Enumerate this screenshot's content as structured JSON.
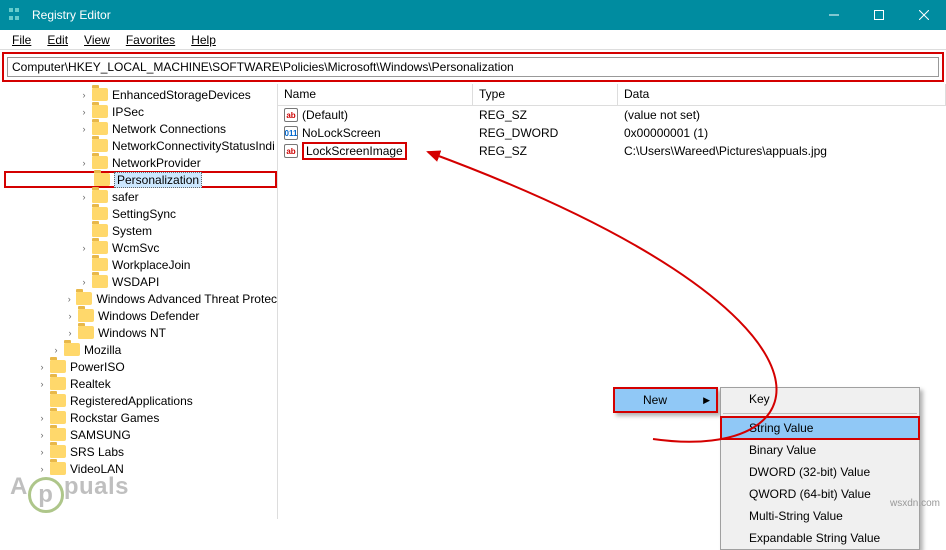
{
  "titlebar": {
    "title": "Registry Editor"
  },
  "menubar": {
    "file": "File",
    "edit": "Edit",
    "view": "View",
    "favorites": "Favorites",
    "help": "Help"
  },
  "address": "Computer\\HKEY_LOCAL_MACHINE\\SOFTWARE\\Policies\\Microsoft\\Windows\\Personalization",
  "tree": {
    "indentBase": 28,
    "items": [
      {
        "label": "EnhancedStorageDevices",
        "indent": 5,
        "twisty": ">"
      },
      {
        "label": "IPSec",
        "indent": 5,
        "twisty": ">"
      },
      {
        "label": "Network Connections",
        "indent": 5,
        "twisty": ">"
      },
      {
        "label": "NetworkConnectivityStatusIndi",
        "indent": 5,
        "twisty": ""
      },
      {
        "label": "NetworkProvider",
        "indent": 5,
        "twisty": ">"
      },
      {
        "label": "Personalization",
        "indent": 5,
        "twisty": "",
        "highlight": true
      },
      {
        "label": "safer",
        "indent": 5,
        "twisty": ">"
      },
      {
        "label": "SettingSync",
        "indent": 5,
        "twisty": ""
      },
      {
        "label": "System",
        "indent": 5,
        "twisty": ""
      },
      {
        "label": "WcmSvc",
        "indent": 5,
        "twisty": ">"
      },
      {
        "label": "WorkplaceJoin",
        "indent": 5,
        "twisty": ""
      },
      {
        "label": "WSDAPI",
        "indent": 5,
        "twisty": ">"
      },
      {
        "label": "Windows Advanced Threat Protec",
        "indent": 4,
        "twisty": ">"
      },
      {
        "label": "Windows Defender",
        "indent": 4,
        "twisty": ">"
      },
      {
        "label": "Windows NT",
        "indent": 4,
        "twisty": ">"
      },
      {
        "label": "Mozilla",
        "indent": 3,
        "twisty": ">"
      },
      {
        "label": "PowerISO",
        "indent": 2,
        "twisty": ">"
      },
      {
        "label": "Realtek",
        "indent": 2,
        "twisty": ">"
      },
      {
        "label": "RegisteredApplications",
        "indent": 2,
        "twisty": ""
      },
      {
        "label": "Rockstar Games",
        "indent": 2,
        "twisty": ">"
      },
      {
        "label": "SAMSUNG",
        "indent": 2,
        "twisty": ">"
      },
      {
        "label": "SRS Labs",
        "indent": 2,
        "twisty": ">"
      },
      {
        "label": "VideoLAN",
        "indent": 2,
        "twisty": ">"
      }
    ]
  },
  "list": {
    "headers": {
      "name": "Name",
      "type": "Type",
      "data": "Data"
    },
    "rows": [
      {
        "iconClass": "str",
        "iconText": "ab",
        "name": "(Default)",
        "type": "REG_SZ",
        "data": "(value not set)",
        "highlight": false
      },
      {
        "iconClass": "bin",
        "iconText": "011",
        "name": "NoLockScreen",
        "type": "REG_DWORD",
        "data": "0x00000001 (1)",
        "highlight": false
      },
      {
        "iconClass": "str",
        "iconText": "ab",
        "name": "LockScreenImage",
        "type": "REG_SZ",
        "data": "C:\\Users\\Wareed\\Pictures\\appuals.jpg",
        "highlight": true
      }
    ]
  },
  "contextmenu": {
    "new": "New"
  },
  "submenu": {
    "key": "Key",
    "string": "String Value",
    "binary": "Binary Value",
    "dword": "DWORD (32-bit) Value",
    "qword": "QWORD (64-bit) Value",
    "multi": "Multi-String Value",
    "expand": "Expandable String Value"
  },
  "watermark": {
    "left": "A",
    "right": "puals"
  },
  "copyright": "wsxdn.com"
}
